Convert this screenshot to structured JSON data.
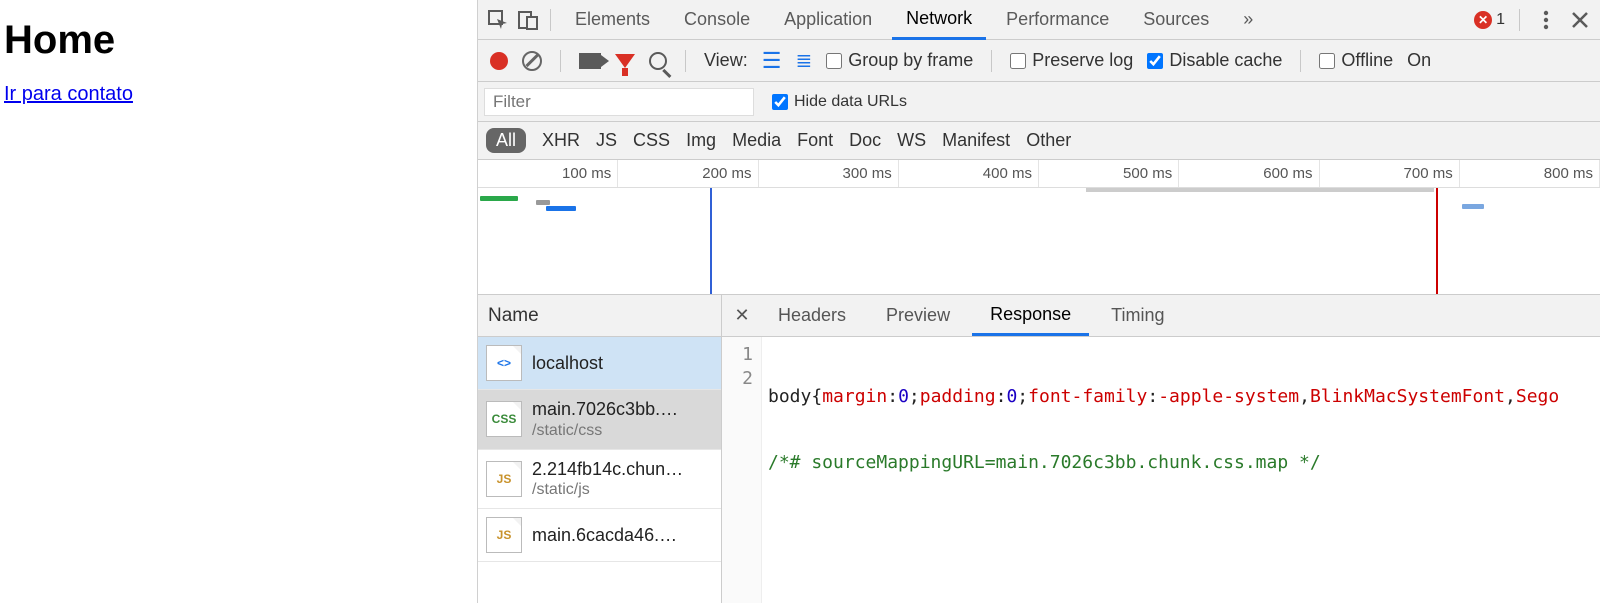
{
  "page": {
    "title": "Home",
    "link": "Ir para contato"
  },
  "devtools": {
    "tabs": [
      "Elements",
      "Console",
      "Application",
      "Network",
      "Performance",
      "Sources"
    ],
    "active_tab": "Network",
    "more_glyph": "»",
    "error_count": "1",
    "selector_icon": "inspect-icon",
    "device_icon": "device-icon",
    "menu_icon": "kebab-icon",
    "close_icon": "close-icon"
  },
  "toolbar": {
    "view_label": "View:",
    "group_by_frame": "Group by frame",
    "preserve_log": "Preserve log",
    "disable_cache": "Disable cache",
    "offline": "Offline",
    "online": "On"
  },
  "filterbar": {
    "filter_placeholder": "Filter",
    "hide_data_urls": "Hide data URLs"
  },
  "typebar": {
    "all": "All",
    "types": [
      "XHR",
      "JS",
      "CSS",
      "Img",
      "Media",
      "Font",
      "Doc",
      "WS",
      "Manifest",
      "Other"
    ]
  },
  "timeline": {
    "ticks": [
      "100 ms",
      "200 ms",
      "300 ms",
      "400 ms",
      "500 ms",
      "600 ms",
      "700 ms",
      "800 ms"
    ]
  },
  "filelist": {
    "header": "Name",
    "items": [
      {
        "name": "localhost",
        "sub": "",
        "icon": "<>",
        "cls": "html",
        "state": "selected"
      },
      {
        "name": "main.7026c3bb.…",
        "sub": "/static/css",
        "icon": "CSS",
        "cls": "css",
        "state": "active"
      },
      {
        "name": "2.214fb14c.chun…",
        "sub": "/static/js",
        "icon": "JS",
        "cls": "js",
        "state": ""
      },
      {
        "name": "main.6cacda46.…",
        "sub": "",
        "icon": "JS",
        "cls": "js",
        "state": ""
      }
    ]
  },
  "detail": {
    "tabs": [
      "Headers",
      "Preview",
      "Response",
      "Timing"
    ],
    "active": "Response",
    "lines": [
      "1",
      "2"
    ],
    "code": {
      "l1": {
        "a": "body{",
        "b": "margin",
        "c": ":",
        "d": "0",
        "e": ";",
        "f": "padding",
        "g": ":",
        "h": "0",
        "i": ";",
        "j": "font-family",
        "k": ":",
        "l": "-apple-system",
        "m": ",",
        "n": "BlinkMacSystemFont",
        "o": ",",
        "p": "Sego"
      },
      "l2": "/*# sourceMappingURL=main.7026c3bb.chunk.css.map */"
    }
  }
}
